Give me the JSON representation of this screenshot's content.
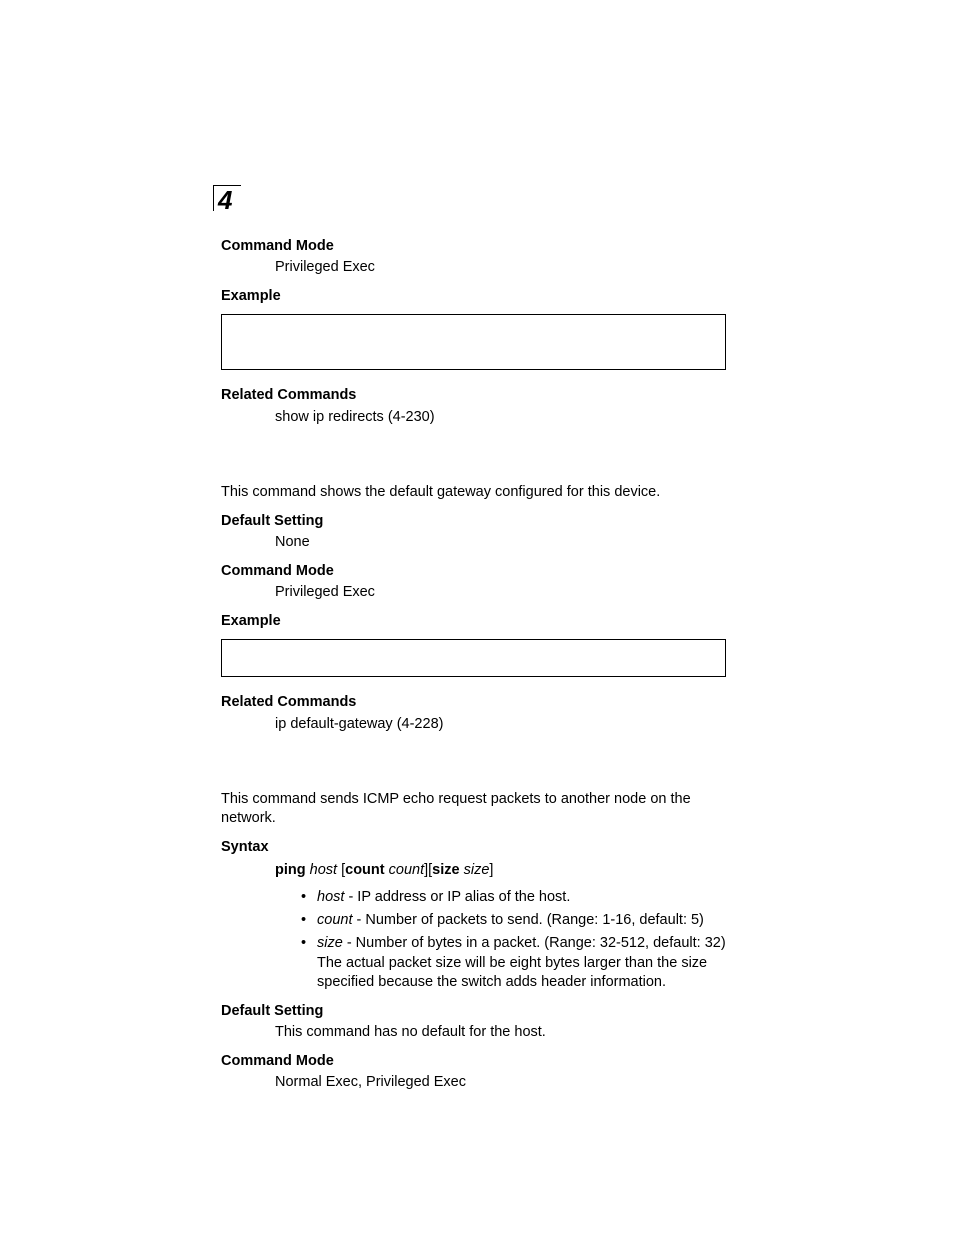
{
  "chapter_number": "4",
  "section1": {
    "command_mode_h": "Command Mode",
    "command_mode_v": "Privileged Exec",
    "example_h": "Example",
    "related_h": "Related Commands",
    "related_v": "show ip redirects (4-230)"
  },
  "section2": {
    "intro": "This command shows the default gateway configured for this device.",
    "default_setting_h": "Default Setting",
    "default_setting_v": "None",
    "command_mode_h": "Command Mode",
    "command_mode_v": "Privileged Exec",
    "example_h": "Example",
    "related_h": "Related Commands",
    "related_v": "ip default-gateway (4-228)"
  },
  "section3": {
    "intro": "This command sends ICMP echo request packets to another node on the network.",
    "syntax_h": "Syntax",
    "syntax_cmd_b1": "ping",
    "syntax_cmd_i1": "host",
    "syntax_cmd_br1": "[",
    "syntax_cmd_b2": "count",
    "syntax_cmd_i2": "count",
    "syntax_cmd_br2": "][",
    "syntax_cmd_b3": "size",
    "syntax_cmd_i3": "size",
    "syntax_cmd_br3": "]",
    "bullets": {
      "b1_i": "host",
      "b1_t": " - IP address or IP alias of the host.",
      "b2_i": "count",
      "b2_t": " - Number of packets to send. (Range: 1-16, default: 5)",
      "b3_i": "size",
      "b3_t": " - Number of bytes in a packet. (Range: 32-512, default: 32) The actual packet size will be eight bytes larger than the size specified because the switch adds header information."
    },
    "default_setting_h": "Default Setting",
    "default_setting_v": "This command has no default for the host.",
    "command_mode_h": "Command Mode",
    "command_mode_v": "Normal Exec, Privileged Exec"
  }
}
